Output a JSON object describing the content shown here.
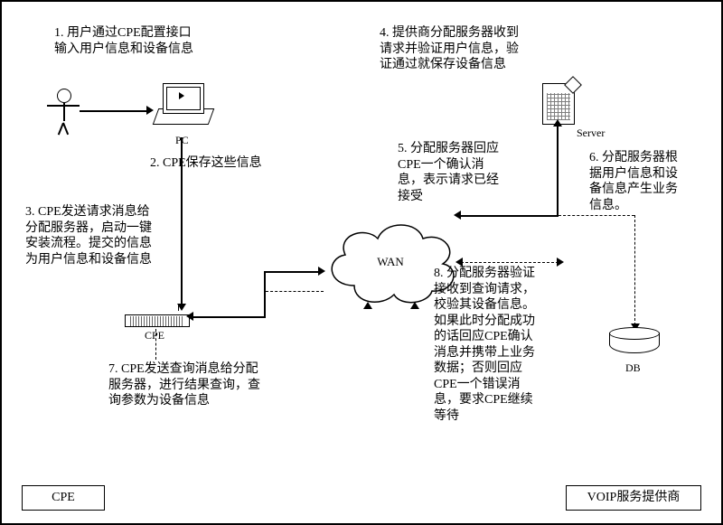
{
  "steps": {
    "s1": "1. 用户通过CPE配置接口\n输入用户信息和设备信息",
    "s2": "2. CPE保存这些信息",
    "s3": "3. CPE发送请求消息给\n分配服务器，启动一键\n安装流程。提交的信息\n为用户信息和设备信息",
    "s4": "4. 提供商分配服务器收到\n请求并验证用户信息，验\n证通过就保存设备信息",
    "s5": "5. 分配服务器回应\nCPE一个确认消\n息，表示请求已经\n接受",
    "s6": "6. 分配服务器根\n据用户信息和设\n备信息产生业务\n信息。",
    "s7": "7. CPE发送查询消息给分配\n服务器，进行结果查询，查\n询参数为设备信息",
    "s8": "8. 分配服务器验证\n接收到查询请求，\n校验其设备信息。\n如果此时分配成功\n的话回应CPE确认\n消息并携带上业务\n数据；否则回应\nCPE一个错误消\n息，要求CPE继续\n等待"
  },
  "labels": {
    "pc": "PC",
    "cpe_dev": "CPE",
    "server": "Server",
    "db": "DB",
    "wan": "WAN"
  },
  "boxes": {
    "cpe": "CPE",
    "provider": "VOIP服务提供商"
  }
}
